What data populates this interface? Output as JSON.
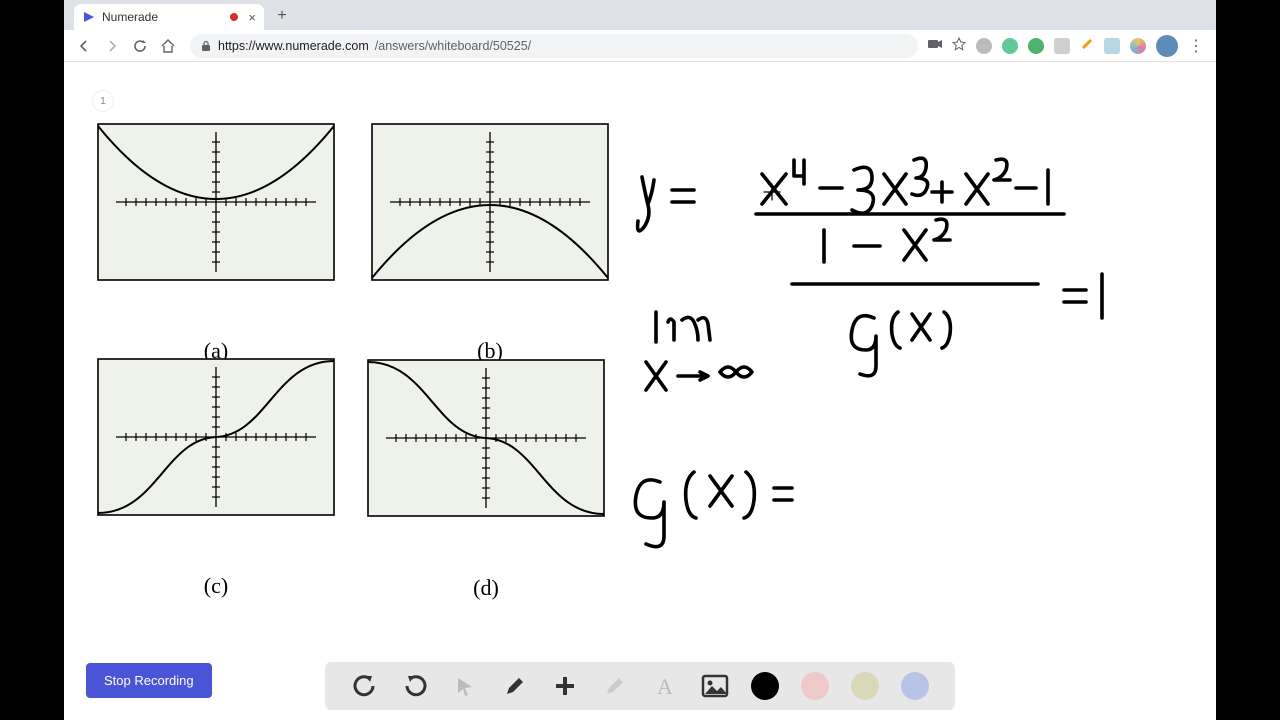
{
  "browser": {
    "tab_title": "Numerade",
    "url_host": "https://www.numerade.com",
    "url_path": "/answers/whiteboard/50525/",
    "close_glyph": "×",
    "newtab_glyph": "+"
  },
  "page": {
    "indicator": "1"
  },
  "graphs": {
    "a_label": "(a)",
    "b_label": "(b)",
    "c_label": "(c)",
    "d_label": "(d)"
  },
  "footer": {
    "stop_label": "Stop Recording"
  },
  "colors": {
    "accent": "#4a54d6",
    "graph_bg": "#eef2ea"
  }
}
